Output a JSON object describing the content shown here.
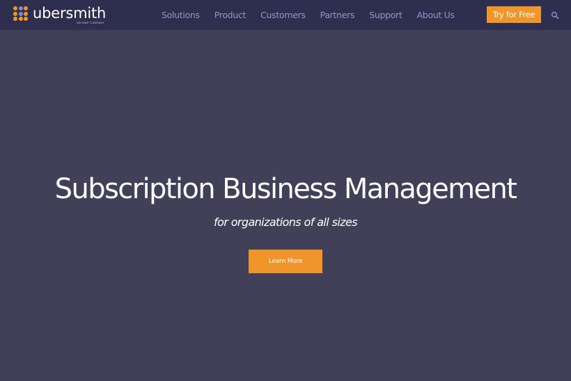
{
  "brand": {
    "name": "ubersmith",
    "tagline": "AN INAP COMPANY",
    "logo_dot_colors": [
      "#f0952a",
      "#8a87c4",
      "#f0952a",
      "#f0952a",
      "#8a87c4",
      "#f0952a",
      "#f0952a",
      "#f0952a",
      "#f0952a"
    ]
  },
  "nav": {
    "items": [
      {
        "label": "Solutions"
      },
      {
        "label": "Product"
      },
      {
        "label": "Customers"
      },
      {
        "label": "Partners"
      },
      {
        "label": "Support"
      },
      {
        "label": "About Us"
      }
    ],
    "cta_label": "Try for Free",
    "search_icon": "search-icon"
  },
  "hero": {
    "title": "Subscription Business Management",
    "subtitle": "for organizations of all sizes",
    "button_label": "Learn More"
  },
  "colors": {
    "nav_bg": "#2e2e4f",
    "hero_bg": "#424058",
    "accent": "#f0952a",
    "nav_link": "#9593c3"
  }
}
